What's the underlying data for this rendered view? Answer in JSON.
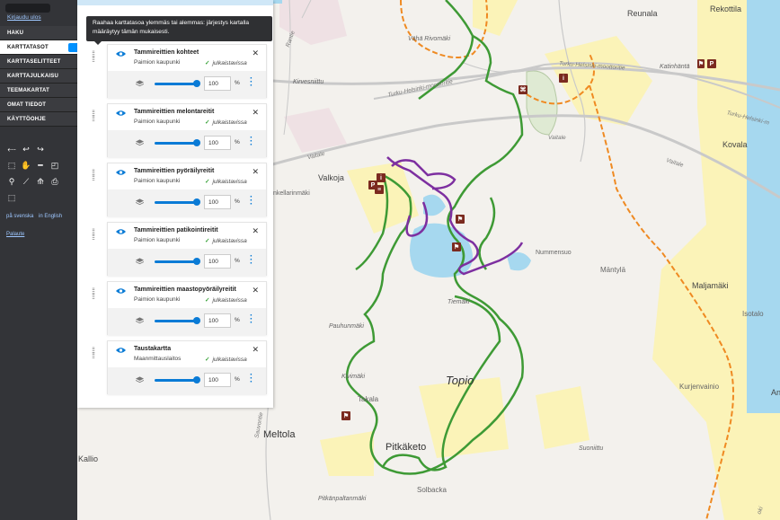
{
  "nav": {
    "logout": "Kirjaudu ulos",
    "items": [
      {
        "label": "HAKU"
      },
      {
        "label": "KARTTATASOT"
      },
      {
        "label": "KARTTASELITTEET"
      },
      {
        "label": "KARTTAJULKAISU"
      },
      {
        "label": "TEEMAKARTAT"
      },
      {
        "label": "OMAT TIEDOT"
      },
      {
        "label": "KÄYTTÖOHJE"
      }
    ],
    "lang_sv": "på svenska",
    "lang_en": "in English",
    "feedback": "Palaute"
  },
  "tooltip": "Raahaa karttatasoa ylemmäs tai alemmas: järjestys kartalla määräytyy tämän mukaisesti.",
  "layers": [
    {
      "name": "Tammireittien kohteet",
      "org": "Paimion kaupunki",
      "status": "julkaistavissa",
      "opacity": "100",
      "unit": "%"
    },
    {
      "name": "Tammireittien melontareitit",
      "org": "Paimion kaupunki",
      "status": "julkaistavissa",
      "opacity": "100",
      "unit": "%"
    },
    {
      "name": "Tammireittien pyöräilyreitit",
      "org": "Paimion kaupunki",
      "status": "julkaistavissa",
      "opacity": "100",
      "unit": "%"
    },
    {
      "name": "Tammireittien patikointireitit",
      "org": "Paimion kaupunki",
      "status": "julkaistavissa",
      "opacity": "100",
      "unit": "%"
    },
    {
      "name": "Tammireittien maastopyöräilyreitit",
      "org": "Paimion kaupunki",
      "status": "julkaistavissa",
      "opacity": "100",
      "unit": "%"
    },
    {
      "name": "Taustakartta",
      "org": "Maanmittauslaitos",
      "status": "julkaistavissa",
      "opacity": "100",
      "unit": "%"
    }
  ],
  "map": {
    "places": {
      "reunala": "Reunala",
      "rekottila": "Rekottila",
      "vaha_rivomaki": "Vähä Rivomäki",
      "katinhanta": "Katinhäntä",
      "kirvesniittu": "Kirvesniittu",
      "turku_helsinki_1": "Turku-Helsinki-moottoritie",
      "turku_helsinki_2": "Turku-Helsinki-moottoritie",
      "turku_helsinki_3": "Turku-Helsinki-m",
      "vaitale_1": "Vaitale",
      "vaitale_2": "Vaitale",
      "vaitale_3": "Vaitale",
      "kovala": "Kovala",
      "valkoja": "Valkoja",
      "kellarinmaki": "nkellarinmäki",
      "nummensuo": "Nummensuo",
      "mantyla": "Mäntylä",
      "maljamaki": "Maljamäki",
      "isotalo": "Isotalo",
      "tiemaki": "Tiemäki",
      "pauhumaki": "Pauhunmäki",
      "topio": "Topio",
      "kivimaki": "Kivimäki",
      "takala": "Takala",
      "kurjenvainio": "Kurjenvainio",
      "an": "An",
      "meltola": "Meltola",
      "pitkaketo": "Pitkäketo",
      "suoniittu": "Suoniittu",
      "kallio": "Kallio",
      "solbacka": "Solbacka",
      "pitkanpaltanmaki": "Pitkänpaltanmäki",
      "rantie": "Rantie",
      "saurvontie": "Sauvontie",
      "tiemaki_road": "Tiemäki",
      "okl": "oki"
    },
    "colors": {
      "hiking": "#3e9a35",
      "cycling": "#7d2fa0",
      "highway_orange": "#ef8a22",
      "water": "#a6d8ef",
      "field": "#fbf3b8"
    }
  }
}
